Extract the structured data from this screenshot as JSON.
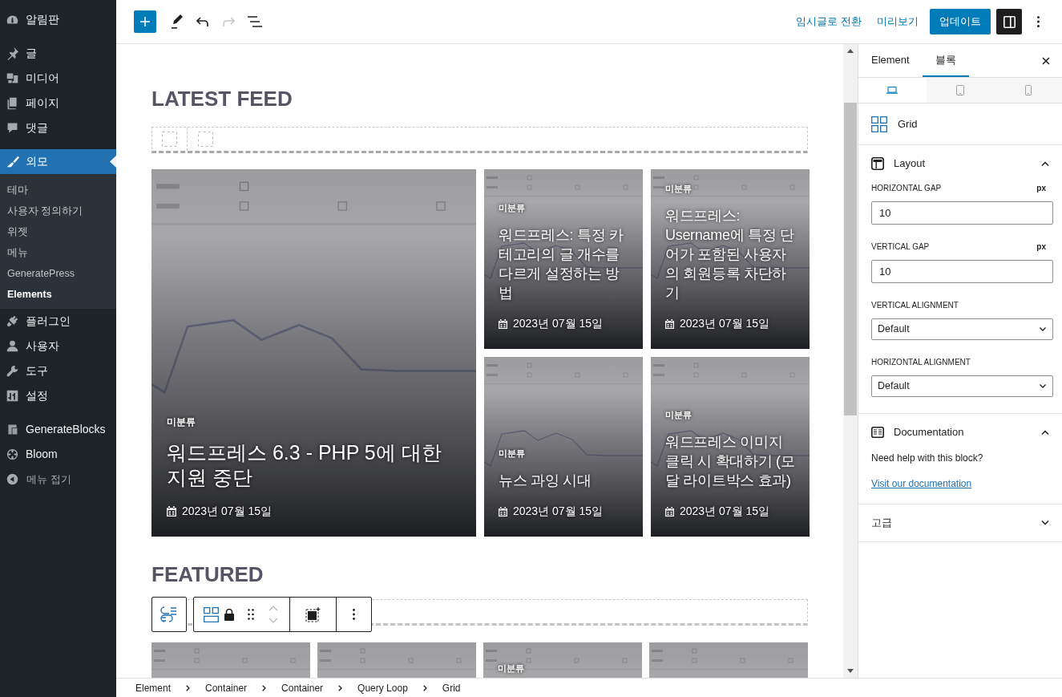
{
  "sidebar": {
    "groups": [
      [
        {
          "label": "알림판",
          "selected": false
        }
      ],
      [
        {
          "label": "글",
          "selected": false
        },
        {
          "label": "미디어",
          "selected": false
        },
        {
          "label": "페이지",
          "selected": false
        },
        {
          "label": "댓글",
          "selected": false
        }
      ],
      [
        {
          "label": "외모",
          "selected": true,
          "children": [
            {
              "label": "테마",
              "selected": false
            },
            {
              "label": "사용자 정의하기",
              "selected": false
            },
            {
              "label": "위젯",
              "selected": false
            },
            {
              "label": "메뉴",
              "selected": false
            },
            {
              "label": "GeneratePress",
              "selected": false
            },
            {
              "label": "Elements",
              "selected": true
            }
          ]
        },
        {
          "label": "플러그인",
          "selected": false
        },
        {
          "label": "사용자",
          "selected": false
        },
        {
          "label": "도구",
          "selected": false
        },
        {
          "label": "설정",
          "selected": false
        }
      ],
      [
        {
          "label": "GenerateBlocks",
          "selected": false
        },
        {
          "label": "Bloom",
          "selected": false
        }
      ]
    ],
    "collapse": "메뉴 접기"
  },
  "top_bar": {
    "undo": {
      "disabled": false
    },
    "redo": {
      "disabled": true
    },
    "links": [
      "임시글로 전환",
      "미리보기"
    ],
    "update": "업데이트",
    "settings_pressed": true
  },
  "canvas": {
    "sections": [
      {
        "heading": "LATEST FEED",
        "posts": [
          {
            "kind": "post",
            "category": "미분류",
            "title": "워드프레스 6.3 - PHP 5에 대한 지원 중단",
            "date": "2023년 07월 15일"
          },
          {
            "kind": "post",
            "category": "미분류",
            "title": "워드프레스: 특정 카테고리의 글 개수를 다르게 설정하는 방법",
            "date": "2023년 07월 15일"
          },
          {
            "kind": "post",
            "category": "미분류",
            "title": "워드프레스: Username에 특정 단어가 포함된 사용자의 회원등록 차단하기",
            "date": "2023년 07월 15일"
          },
          {
            "kind": "post",
            "category": "미분류",
            "title": "뉴스 과잉 시대",
            "date": "2023년 07월 15일"
          },
          {
            "kind": "post",
            "category": "미분류",
            "title": "워드프레스 이미지 클릭 시 확대하기 (모달 라이트박스 효과)",
            "date": "2023년 07월 15일"
          }
        ]
      },
      {
        "heading": "FEATURED",
        "selected_block": true,
        "posts": [
          {
            "kind": "picture"
          },
          {
            "kind": "picture"
          },
          {
            "kind": "post",
            "category": "미분류"
          },
          {
            "kind": "picture"
          }
        ]
      }
    ]
  },
  "inspector": {
    "tabs": [
      {
        "label": "Element",
        "selected": false
      },
      {
        "label": "블록",
        "selected": true
      }
    ],
    "devices": [
      {
        "kind": "desktop",
        "selected": true
      },
      {
        "kind": "tablet",
        "selected": false
      },
      {
        "kind": "mobile",
        "selected": false
      }
    ],
    "block": "Grid",
    "panels": [
      {
        "kind": "layout",
        "title": "Layout",
        "expanded": true,
        "fields": [
          {
            "kind": "number",
            "label": "HORIZONTAL GAP",
            "unit": "px",
            "value": "10"
          },
          {
            "kind": "number",
            "label": "VERTICAL GAP",
            "unit": "px",
            "value": "10"
          },
          {
            "kind": "select",
            "label": "VERTICAL ALIGNMENT",
            "value": "Default"
          },
          {
            "kind": "select",
            "label": "HORIZONTAL ALIGNMENT",
            "value": "Default"
          }
        ]
      },
      {
        "kind": "docs",
        "title": "Documentation",
        "expanded": true,
        "text": "Need help with this block?",
        "link": "Visit our documentation"
      },
      {
        "kind": "plain",
        "title": "고급",
        "expanded": false
      }
    ]
  },
  "breadcrumb": [
    "Element",
    "Container",
    "Container",
    "Query Loop",
    "Grid"
  ]
}
